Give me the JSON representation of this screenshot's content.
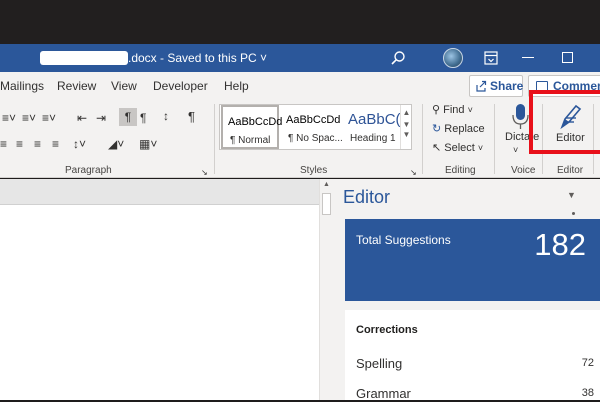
{
  "titlebar": {
    "doc_title": ".docx  -  Saved to this PC ˅"
  },
  "menu_tabs": [
    "Mailings",
    "Review",
    "View",
    "Developer",
    "Help"
  ],
  "share_label": "Share",
  "comments_label": "Comments",
  "ribbon": {
    "paragraph_label": "Paragraph",
    "styles_label": "Styles",
    "editing_label": "Editing",
    "voice_label": "Voice",
    "editor_group_label": "Editor",
    "styles": [
      {
        "sample": "AaBbCcDd",
        "name": "¶ Normal"
      },
      {
        "sample": "AaBbCcDd",
        "name": "¶ No Spac..."
      },
      {
        "sample": "AaBbC(",
        "name": "Heading 1"
      }
    ],
    "find_label": "Find",
    "replace_label": "Replace",
    "select_label": "Select",
    "dictate_label": "Dictate",
    "editor_label": "Editor"
  },
  "editor_pane": {
    "title": "Editor",
    "total_suggestions_label": "Total Suggestions",
    "total_suggestions_count": "182",
    "corrections_title": "Corrections",
    "corrections": [
      {
        "label": "Spelling",
        "count": "72"
      },
      {
        "label": "Grammar",
        "count": "38"
      }
    ]
  },
  "colors": {
    "accent": "#2b579a",
    "highlight": "#e8101a"
  }
}
